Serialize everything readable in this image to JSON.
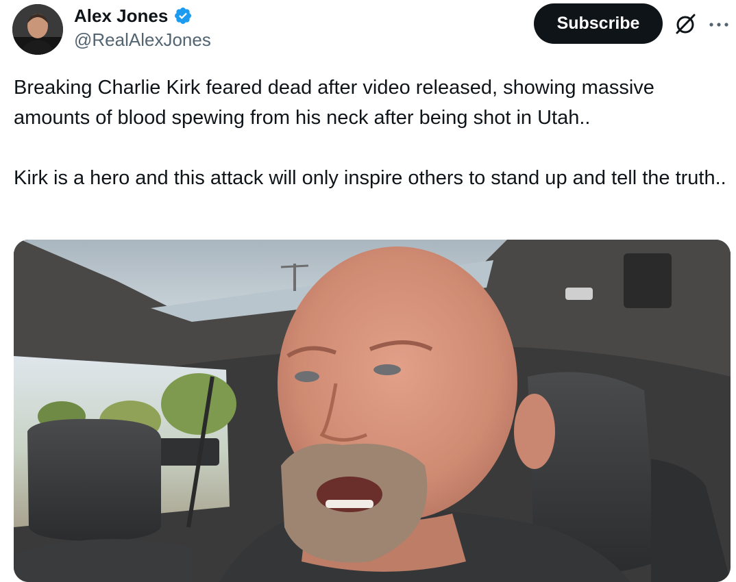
{
  "author": {
    "display_name": "Alex Jones",
    "handle": "@RealAlexJones",
    "verified": true,
    "avatar_icon": "profile-photo"
  },
  "actions": {
    "subscribe_label": "Subscribe",
    "grok_icon": "grok-icon",
    "more_icon": "more-options-icon"
  },
  "tweet": {
    "paragraphs": [
      "Breaking Charlie Kirk feared dead after video released, showing massive amounts of blood spewing from his neck after being shot in Utah..",
      "Kirk is a hero and this attack will only inspire others to stand up and tell the truth.."
    ]
  },
  "media": {
    "type": "video-thumbnail",
    "alt": "Man filming himself in the driver seat of a car"
  },
  "colors": {
    "text": "#0f1419",
    "secondary": "#536471",
    "verified_blue": "#1d9bf0",
    "button_bg": "#0f1419",
    "background": "#ffffff"
  }
}
